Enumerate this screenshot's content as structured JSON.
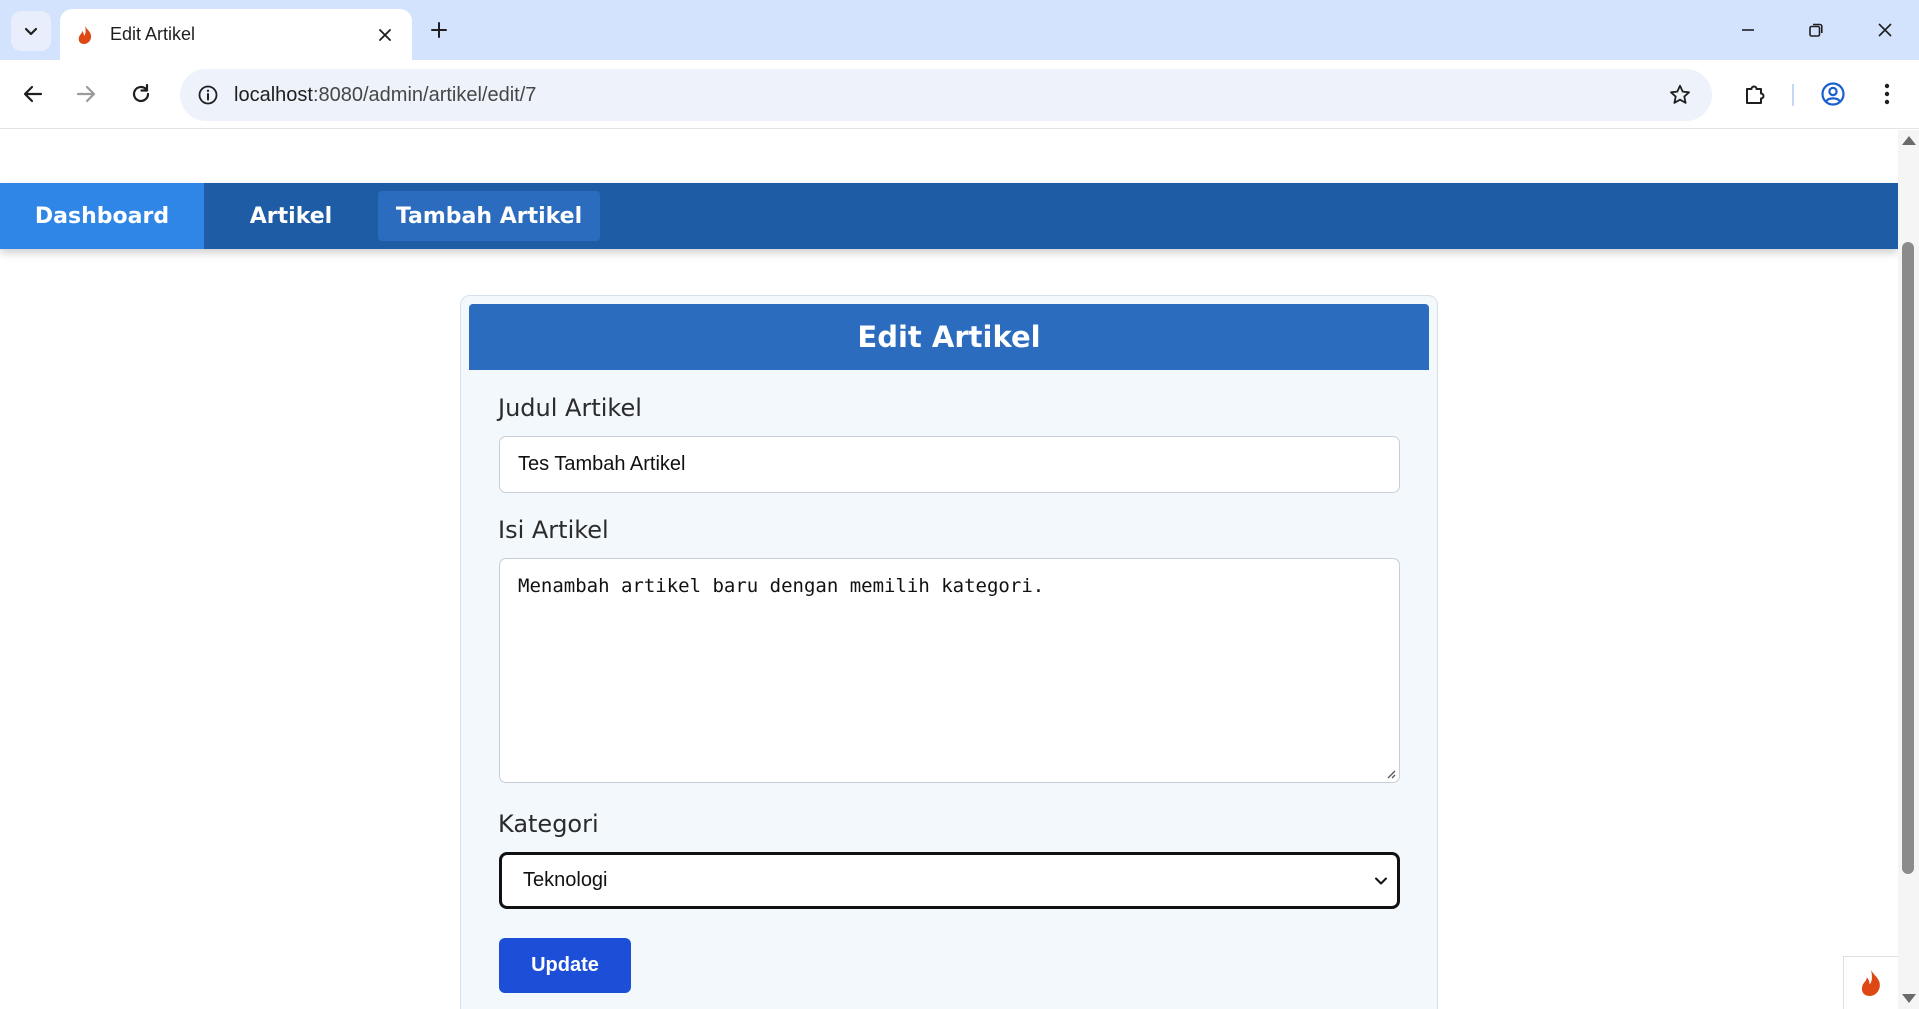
{
  "browser": {
    "tab": {
      "title": "Edit Artikel",
      "favicon": "codeigniter-flame-icon"
    },
    "url": {
      "host": "localhost",
      "rest": ":8080/admin/artikel/edit/7"
    }
  },
  "navbar": {
    "items": [
      {
        "label": "Dashboard"
      },
      {
        "label": "Artikel"
      },
      {
        "label": "Tambah Artikel"
      }
    ]
  },
  "form": {
    "title": "Edit Artikel",
    "judul_label": "Judul Artikel",
    "judul_value": "Tes Tambah Artikel",
    "isi_label": "Isi Artikel",
    "isi_value": "Menambah artikel baru dengan memilih kategori.",
    "kategori_label": "Kategori",
    "kategori_value": "Teknologi",
    "submit_label": "Update"
  },
  "colors": {
    "navbar": "#1e5ca6",
    "nav_active": "#2f86e6",
    "card_header": "#2b6cbf",
    "button": "#1d4ed8"
  }
}
